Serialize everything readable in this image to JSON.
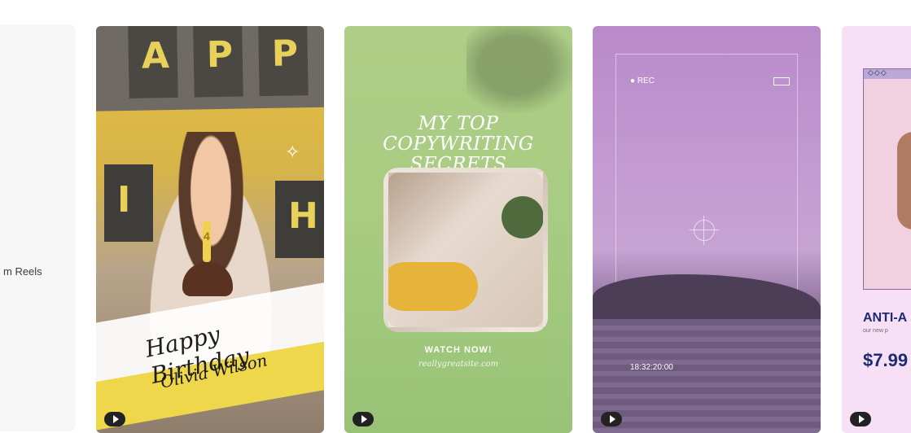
{
  "left_card": {
    "label": "m Reels"
  },
  "cards": [
    {
      "banner_letters": [
        "A",
        "P",
        "P"
      ],
      "lower_banner_letters": [
        "I",
        "H"
      ],
      "script_line_1": "Happy Birthday",
      "script_line_2": "Olivia Wilson",
      "candle_number": "4"
    },
    {
      "headline": "MY TOP COPYWRITING SECRETS",
      "cta": "WATCH NOW!",
      "site": "reallygreatsite.com"
    },
    {
      "rec_label": "● REC",
      "timestamp": "18:32:20:00"
    },
    {
      "window_controls": "◇◇◇",
      "title": "ANTI-A",
      "subtitle": "our new p",
      "price": "$7.99"
    }
  ]
}
